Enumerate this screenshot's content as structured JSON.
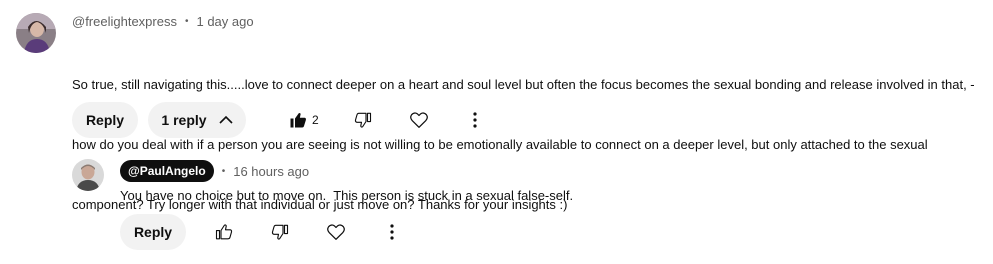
{
  "comment": {
    "handle": "@freelightexpress",
    "time": "1 day ago",
    "lines": [
      "So true, still navigating this.....love to connect deeper on a heart and soul level but often the focus becomes the sexual bonding and release involved in that, -",
      "how do you deal with if a person you are seeing is not willing to be emotionally available to connect on a deeper level, but only attached to the sexual",
      "component? Try longer with that individual or just move on? Thanks for your insights :)"
    ],
    "reply_label": "Reply",
    "replies_label": "1 reply",
    "like_count": "2"
  },
  "reply": {
    "handle": "@PaulAngelo",
    "time": "16 hours ago",
    "text": "You have no choice but to move on.  This person is stuck in a sexual false-self.",
    "reply_label": "Reply"
  },
  "separator": "•",
  "icons": {
    "like_filled": "thumbs-up-filled-icon",
    "like": "thumbs-up-icon",
    "dislike": "thumbs-down-icon",
    "heart": "heart-icon",
    "more": "more-vert-icon",
    "chevron": "chevron-up-icon"
  }
}
